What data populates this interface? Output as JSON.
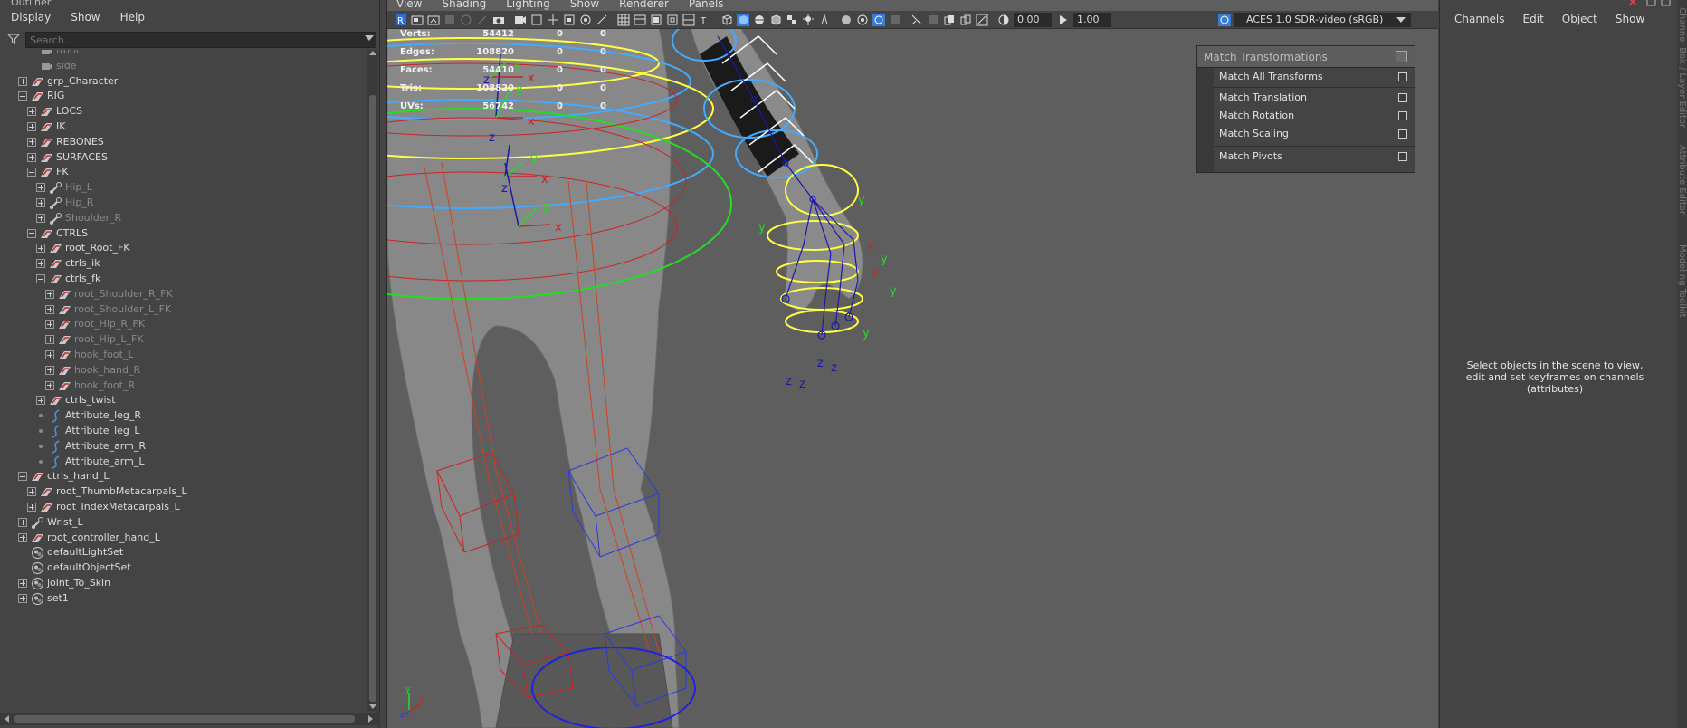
{
  "outliner": {
    "title": "Outliner",
    "menu": [
      "Display",
      "Show",
      "Help"
    ],
    "search_placeholder": "Search...",
    "items": [
      {
        "label": "front",
        "depth": 1,
        "expander": "none",
        "icon": "camera-icon",
        "dim": true
      },
      {
        "label": "side",
        "depth": 1,
        "expander": "none",
        "icon": "camera-icon",
        "dim": true
      },
      {
        "label": "grp_Character",
        "depth": 0,
        "expander": "plus",
        "icon": "transform-icon",
        "dim": false
      },
      {
        "label": "RIG",
        "depth": 0,
        "expander": "minus",
        "icon": "transform-icon",
        "dim": false
      },
      {
        "label": "LOCS",
        "depth": 1,
        "expander": "plus",
        "icon": "transform-icon",
        "dim": false
      },
      {
        "label": "IK",
        "depth": 1,
        "expander": "plus",
        "icon": "transform-icon",
        "dim": false
      },
      {
        "label": "REBONES",
        "depth": 1,
        "expander": "plus",
        "icon": "transform-icon",
        "dim": false
      },
      {
        "label": "SURFACES",
        "depth": 1,
        "expander": "plus",
        "icon": "transform-icon",
        "dim": false
      },
      {
        "label": "FK",
        "depth": 1,
        "expander": "minus",
        "icon": "transform-icon",
        "dim": false
      },
      {
        "label": "Hip_L",
        "depth": 2,
        "expander": "plus",
        "icon": "joint-icon",
        "dim": true
      },
      {
        "label": "Hip_R",
        "depth": 2,
        "expander": "plus",
        "icon": "joint-icon",
        "dim": true
      },
      {
        "label": "Shoulder_R",
        "depth": 2,
        "expander": "plus",
        "icon": "joint-icon",
        "dim": true
      },
      {
        "label": "CTRLS",
        "depth": 1,
        "expander": "minus",
        "icon": "transform-icon",
        "dim": false
      },
      {
        "label": "root_Root_FK",
        "depth": 2,
        "expander": "plus",
        "icon": "transform-icon",
        "dim": false
      },
      {
        "label": "ctrls_ik",
        "depth": 2,
        "expander": "plus",
        "icon": "transform-icon",
        "dim": false
      },
      {
        "label": "ctrls_fk",
        "depth": 2,
        "expander": "minus",
        "icon": "transform-icon",
        "dim": false
      },
      {
        "label": "root_Shoulder_R_FK",
        "depth": 3,
        "expander": "plus",
        "icon": "transform-icon",
        "dim": true
      },
      {
        "label": "root_Shoulder_L_FK",
        "depth": 3,
        "expander": "plus",
        "icon": "transform-icon",
        "dim": true
      },
      {
        "label": "root_Hip_R_FK",
        "depth": 3,
        "expander": "plus",
        "icon": "transform-icon",
        "dim": true
      },
      {
        "label": "root_Hip_L_FK",
        "depth": 3,
        "expander": "plus",
        "icon": "transform-icon",
        "dim": true
      },
      {
        "label": "hook_foot_L",
        "depth": 3,
        "expander": "plus",
        "icon": "transform-icon",
        "dim": true
      },
      {
        "label": "hook_hand_R",
        "depth": 3,
        "expander": "plus",
        "icon": "transform-icon",
        "dim": true
      },
      {
        "label": "hook_foot_R",
        "depth": 3,
        "expander": "plus",
        "icon": "transform-icon",
        "dim": true
      },
      {
        "label": "ctrls_twist",
        "depth": 2,
        "expander": "plus",
        "icon": "transform-icon",
        "dim": false
      },
      {
        "label": "Attribute_leg_R",
        "depth": 2,
        "expander": "dot",
        "icon": "curve-icon",
        "dim": false
      },
      {
        "label": "Attribute_leg_L",
        "depth": 2,
        "expander": "dot",
        "icon": "curve-icon",
        "dim": false
      },
      {
        "label": "Attribute_arm_R",
        "depth": 2,
        "expander": "dot",
        "icon": "curve-icon",
        "dim": false
      },
      {
        "label": "Attribute_arm_L",
        "depth": 2,
        "expander": "dot",
        "icon": "curve-icon",
        "dim": false
      },
      {
        "label": "ctrls_hand_L",
        "depth": 0,
        "expander": "minus",
        "icon": "transform-icon",
        "dim": false
      },
      {
        "label": "root_ThumbMetacarpals_L",
        "depth": 1,
        "expander": "plus",
        "icon": "transform-icon",
        "dim": false
      },
      {
        "label": "root_IndexMetacarpals_L",
        "depth": 1,
        "expander": "plus",
        "icon": "transform-icon",
        "dim": false
      },
      {
        "label": "Wrist_L",
        "depth": 0,
        "expander": "plus",
        "icon": "joint-icon",
        "dim": false
      },
      {
        "label": "root_controller_hand_L",
        "depth": 0,
        "expander": "plus",
        "icon": "transform-icon",
        "dim": false
      },
      {
        "label": "defaultLightSet",
        "depth": 0,
        "expander": "none",
        "icon": "set-icon",
        "dim": false
      },
      {
        "label": "defaultObjectSet",
        "depth": 0,
        "expander": "none",
        "icon": "set-icon",
        "dim": false
      },
      {
        "label": "joint_To_Skin",
        "depth": 0,
        "expander": "plus",
        "icon": "set-icon",
        "dim": false
      },
      {
        "label": "set1",
        "depth": 0,
        "expander": "plus",
        "icon": "set-icon",
        "dim": false
      }
    ]
  },
  "viewport": {
    "menu": [
      "View",
      "Shading",
      "Lighting",
      "Show",
      "Renderer",
      "Panels"
    ],
    "exposure_value": "0.00",
    "gamma_value": "1.00",
    "color_space": "ACES 1.0 SDR-video (sRGB)",
    "hud": {
      "rows": [
        {
          "label": "Verts:",
          "v1": "54412",
          "v2": "0",
          "v3": "0"
        },
        {
          "label": "Edges:",
          "v1": "108820",
          "v2": "0",
          "v3": "0"
        },
        {
          "label": "Faces:",
          "v1": "54410",
          "v2": "0",
          "v3": "0"
        },
        {
          "label": "Tris:",
          "v1": "108820",
          "v2": "0",
          "v3": "0"
        },
        {
          "label": "UVs:",
          "v1": "56742",
          "v2": "0",
          "v3": "0"
        }
      ]
    },
    "axis_labels": {
      "x": "x",
      "y": "y",
      "z": "z"
    },
    "colors": {
      "ctrl_yellow": "#ffff44",
      "ctrl_blue": "#44aaff",
      "ctrl_red": "#cc2222",
      "ctrl_green": "#22dd22",
      "joint_blue": "#1a1aa8",
      "bg": "#5e5e5e"
    }
  },
  "match_panel": {
    "title": "Match Transformations",
    "items": [
      "Match All Transforms",
      "Match Translation",
      "Match Rotation",
      "Match Scaling",
      "Match Pivots"
    ]
  },
  "channel_box": {
    "menu": [
      "Channels",
      "Edit",
      "Object",
      "Show"
    ],
    "message": "Select objects in the scene to view, edit and set keyframes on channels (attributes)"
  },
  "side_tabs": [
    "Channel Box / Layer Editor",
    "Attribute Editor",
    "Modeling Toolkit"
  ]
}
